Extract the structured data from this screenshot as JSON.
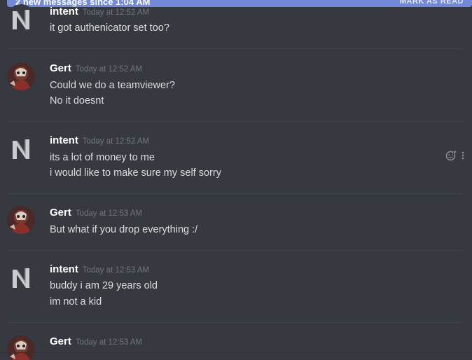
{
  "new_messages_bar": {
    "text": "2 new messages since 1:04 AM",
    "mark_as_read": "MARK AS READ"
  },
  "messages": [
    {
      "author": "intent",
      "timestamp": "Today at 12:52 AM",
      "lines": [
        "it got authenicator set too?"
      ]
    },
    {
      "author": "Gert",
      "timestamp": "Today at 12:52 AM",
      "lines": [
        "Could we do a teamviewer?",
        "No it doesnt"
      ]
    },
    {
      "author": "intent",
      "timestamp": "Today at 12:52 AM",
      "lines": [
        "its a lot of money to me",
        "i would like to make sure my self sorry"
      ]
    },
    {
      "author": "Gert",
      "timestamp": "Today at 12:53 AM",
      "lines": [
        "But what if you drop everything :/"
      ]
    },
    {
      "author": "intent",
      "timestamp": "Today at 12:53 AM",
      "lines": [
        "buddy i am 29 years old",
        "im not a kid"
      ]
    },
    {
      "author": "Gert",
      "timestamp": "Today at 12:53 AM",
      "lines": []
    }
  ],
  "colors": {
    "background": "#36393f",
    "accent": "#7289da",
    "username": "#ffffff",
    "timestamp": "#72767d",
    "message_text": "#dcddde",
    "divider": "#40444b"
  },
  "icons": {
    "add_reaction": "add-reaction-icon",
    "more_options": "more-options-icon"
  }
}
